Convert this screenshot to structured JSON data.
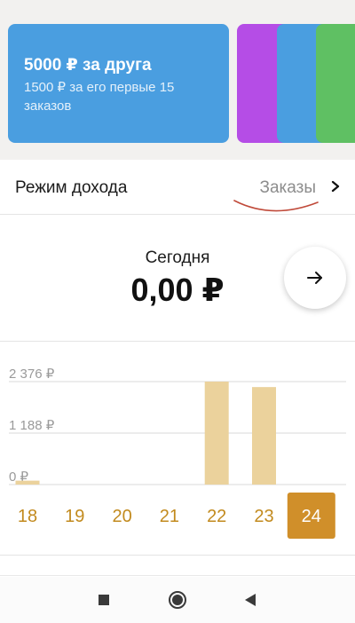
{
  "promo": {
    "title": "5000 ₽ за друга",
    "subtitle": "1500 ₽ за его первые 15 заказов",
    "card_color": "#4a9ee0",
    "next_card_colors": [
      "#b54de6",
      "#4a9ee0",
      "#5fc063"
    ]
  },
  "income_mode": {
    "label": "Режим дохода",
    "value": "Заказы",
    "icon": "chevron-right-icon"
  },
  "today": {
    "label": "Сегодня",
    "amount": "0,00 ₽",
    "next_icon": "arrow-right-icon"
  },
  "chart_data": {
    "type": "bar",
    "categories": [
      "18",
      "19",
      "20",
      "21",
      "22",
      "23",
      "24"
    ],
    "values": [
      90,
      0,
      0,
      0,
      2376,
      2250,
      0
    ],
    "y_tick_labels": [
      "2 376 ₽",
      "1 188 ₽",
      "0 ₽"
    ],
    "y_ticks": [
      2376,
      1188,
      0
    ],
    "ylim": [
      0,
      2376
    ],
    "selected_category": "24",
    "grid": true,
    "bar_color": "#ebd29c",
    "label_color": "#c28a1e",
    "selected_color": "#d08f2a"
  },
  "nav": {
    "icons": [
      "stop-square-icon",
      "home-circle-icon",
      "back-triangle-icon"
    ]
  }
}
